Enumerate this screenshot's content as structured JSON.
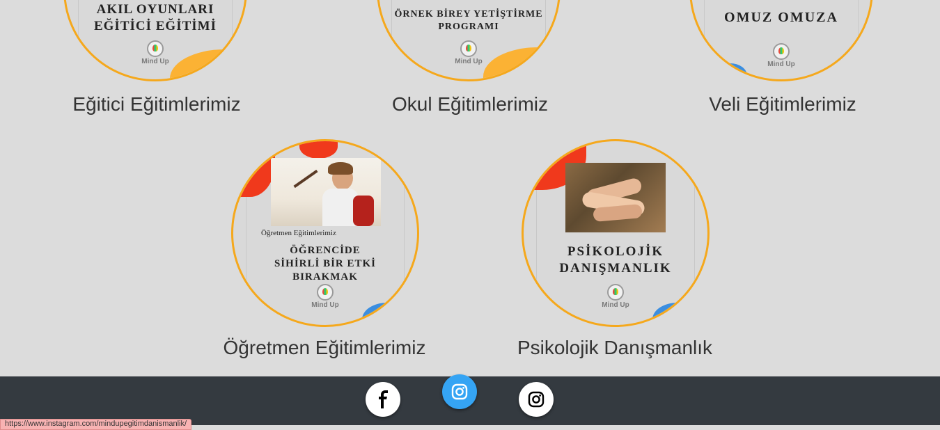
{
  "cards_row1": [
    {
      "poster_lines": [
        "AKIL OYUNLARI",
        "EĞİTİCİ EĞİTİMİ"
      ],
      "logo_text": "Mind Up",
      "title": "Eğitici Eğitimlerimiz"
    },
    {
      "poster_lines": [
        "ÖRNEK BİREY YETİŞTİRME",
        "PROGRAMI"
      ],
      "logo_text": "Mind Up",
      "title": "Okul Eğitimlerimiz"
    },
    {
      "poster_lines": [
        "OMUZ OMUZA"
      ],
      "logo_text": "Mind Up",
      "title": "Veli Eğitimlerimiz"
    }
  ],
  "cards_row2": [
    {
      "poster_caption": "Öğretmen Eğitimlerimiz",
      "poster_lines": [
        "ÖĞRENCİDE",
        "SİHİRLİ BİR ETKİ",
        "BIRAKMAK"
      ],
      "logo_text": "Mind Up",
      "title": "Öğretmen Eğitimlerimiz"
    },
    {
      "poster_lines": [
        "PSİKOLOJİK",
        "DANIŞMANLIK"
      ],
      "logo_text": "Mind Up",
      "title": "Psikolojik Danışmanlık"
    }
  ],
  "footer": {
    "social": [
      {
        "icon": "facebook-icon"
      },
      {
        "icon": "instagram-icon",
        "state": "hover"
      },
      {
        "icon": "instagram-icon"
      }
    ]
  },
  "status_bar": {
    "url": "https://www.instagram.com/mindupegitimdanismanlik/"
  },
  "colors": {
    "ring": "#f5a81c",
    "accent_orange": "#fbb234",
    "accent_red": "#f0391c",
    "accent_blue": "#3b8ee0",
    "footer_bg": "#343a40",
    "active_social": "#35a4f4"
  }
}
